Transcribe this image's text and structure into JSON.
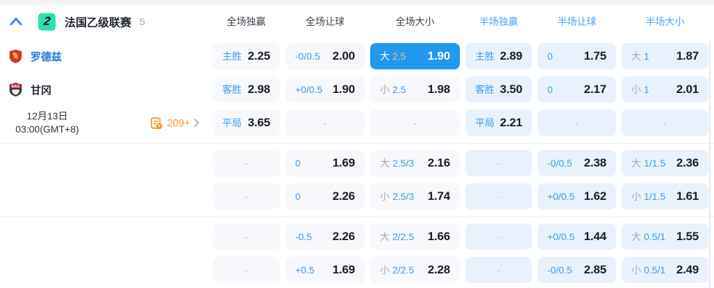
{
  "colors": {
    "highlight_blue": "#2197f0",
    "label_blue": "#3a9af0",
    "half_header_blue": "#4ba3f7",
    "badge_green": "#2ce0ab",
    "orange": "#f79b2e",
    "value_dark": "#1a1d23",
    "highlight_line_yellow": "#e5cd85"
  },
  "header": {
    "league_badge": "2",
    "league_name": "法国乙级联赛",
    "match_count": "5",
    "columns": [
      "全场独赢",
      "全场让球",
      "全场大小",
      "半场独赢",
      "半场让球",
      "半场大小"
    ]
  },
  "match": {
    "home_team": "罗德兹",
    "away_team": "甘冈",
    "date": "12月13日",
    "time": "03:00(GMT+8)",
    "markets_count": "209+"
  },
  "odds_groups": [
    {
      "rows": [
        {
          "left": "home",
          "cells": [
            {
              "label": "主胜",
              "value": "2.25"
            },
            {
              "label": "-0/0.5",
              "value": "2.00"
            },
            {
              "prefix": "大",
              "line": "2.5",
              "value": "1.90",
              "highlight": true
            },
            {
              "label": "主胜",
              "value": "2.89"
            },
            {
              "label": "0",
              "value": "1.75"
            },
            {
              "prefix": "大",
              "line": "1",
              "value": "1.87"
            }
          ]
        },
        {
          "left": "away",
          "cells": [
            {
              "label": "客胜",
              "value": "2.98"
            },
            {
              "label": "+0/0.5",
              "value": "1.90"
            },
            {
              "prefix": "小",
              "line": "2.5",
              "value": "1.98"
            },
            {
              "label": "客胜",
              "value": "3.50"
            },
            {
              "label": "0",
              "value": "2.17"
            },
            {
              "prefix": "小",
              "line": "1",
              "value": "2.01"
            }
          ]
        },
        {
          "left": "meta",
          "cells": [
            {
              "label": "平局",
              "value": "3.65"
            },
            {
              "dash": "-"
            },
            {
              "dash": "-"
            },
            {
              "label": "平局",
              "value": "2.21"
            },
            {
              "dash": "-"
            },
            {
              "dash": "-"
            }
          ]
        }
      ]
    },
    {
      "rows": [
        {
          "left": "",
          "cells": [
            {
              "dash": "-"
            },
            {
              "label": "0",
              "value": "1.69"
            },
            {
              "prefix": "大",
              "line": "2.5/3",
              "value": "2.16"
            },
            {
              "dash": "-"
            },
            {
              "label": "-0/0.5",
              "value": "2.38"
            },
            {
              "prefix": "大",
              "line": "1/1.5",
              "value": "2.36"
            }
          ]
        },
        {
          "left": "",
          "cells": [
            {
              "dash": "-"
            },
            {
              "label": "0",
              "value": "2.26"
            },
            {
              "prefix": "小",
              "line": "2.5/3",
              "value": "1.74"
            },
            {
              "dash": "-"
            },
            {
              "label": "+0/0.5",
              "value": "1.62"
            },
            {
              "prefix": "小",
              "line": "1/1.5",
              "value": "1.61"
            }
          ]
        }
      ]
    },
    {
      "rows": [
        {
          "left": "",
          "cells": [
            {
              "dash": "-"
            },
            {
              "label": "-0.5",
              "value": "2.26"
            },
            {
              "prefix": "大",
              "line": "2/2.5",
              "value": "1.66"
            },
            {
              "dash": "-"
            },
            {
              "label": "+0/0.5",
              "value": "1.44"
            },
            {
              "prefix": "大",
              "line": "0.5/1",
              "value": "1.55"
            }
          ]
        },
        {
          "left": "",
          "cells": [
            {
              "dash": "-"
            },
            {
              "label": "+0.5",
              "value": "1.69"
            },
            {
              "prefix": "小",
              "line": "2/2.5",
              "value": "2.28"
            },
            {
              "dash": "-"
            },
            {
              "label": "-0/0.5",
              "value": "2.85"
            },
            {
              "prefix": "小",
              "line": "0.5/1",
              "value": "2.49"
            }
          ]
        }
      ]
    }
  ]
}
